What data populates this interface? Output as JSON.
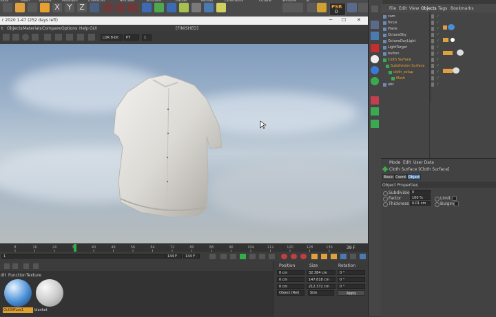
{
  "top_menu": [
    "Tools",
    "Mesh",
    "Volume",
    "MoGraph",
    "Character",
    "Animate",
    "Simulate",
    "Tracker",
    "Render",
    "Extensions",
    "Octane",
    "Window",
    "Script",
    "Help"
  ],
  "psr": {
    "label": "PSR",
    "value": "0"
  },
  "render_window": {
    "title": "r 2020 1-47 (252 days left)",
    "menu": [
      "t",
      "Objects",
      "Materials",
      "Compare",
      "Options",
      "Help",
      "GUI"
    ],
    "status": "[FINISHED]",
    "ldr": "LDR 8-bit",
    "pt": "PT",
    "pt_value": "1"
  },
  "window_controls": {
    "minimize": "─",
    "maximize": "☐",
    "close": "✕"
  },
  "timeline": {
    "ticks": [
      "8",
      "16",
      "24",
      "32",
      "40",
      "48",
      "56",
      "64",
      "72",
      "80",
      "88",
      "96",
      "104",
      "112",
      "120",
      "128",
      "136"
    ],
    "current_frame_fraction": 0.2,
    "end_frame": "39 F",
    "start_field": "1",
    "frame_field": "144 F",
    "frame_field2": "144 F"
  },
  "coords": {
    "headers": [
      "Position",
      "Size",
      "Rotation"
    ],
    "rows": [
      {
        "pos": "0 cm",
        "size": "32.384 cm",
        "rot": "0 °"
      },
      {
        "pos": "0 cm",
        "size": "147.818 cm",
        "rot": "0 °"
      },
      {
        "pos": "0 cm",
        "size": "212.372 cm",
        "rot": "0 °"
      }
    ],
    "mode": "Object (Rel)",
    "size_mode": "Size",
    "apply": "Apply"
  },
  "materials": {
    "menu": [
      "dit",
      "Function",
      "Texture"
    ],
    "items": [
      "OctDiffuse1",
      "blanket"
    ]
  },
  "object_manager": {
    "menu": [
      "File",
      "Edit",
      "View",
      "Objects",
      "Tags",
      "Bookmarks"
    ],
    "objects": [
      {
        "name": "cam",
        "indent": 0,
        "color": "#cfcfcf"
      },
      {
        "name": "focus",
        "indent": 0,
        "color": "#cfcfcf"
      },
      {
        "name": "Plane",
        "indent": 0,
        "color": "#cfcfcf"
      },
      {
        "name": "OctaneSky",
        "indent": 0,
        "color": "#cfcfcf"
      },
      {
        "name": "OctaneDayLight",
        "indent": 0,
        "color": "#cfcfcf"
      },
      {
        "name": "LightTarget",
        "indent": 0,
        "color": "#cfcfcf"
      },
      {
        "name": "button",
        "indent": 0,
        "color": "#cfcfcf"
      },
      {
        "name": "Cloth Surface",
        "indent": 0,
        "color": "#e8b040"
      },
      {
        "name": "Subdivision Surface",
        "indent": 1,
        "color": "#e8a030"
      },
      {
        "name": "cloth_setup",
        "indent": 2,
        "color": "#e8a030"
      },
      {
        "name": "Mesh",
        "indent": 3,
        "color": "#e8a030"
      },
      {
        "name": "abc",
        "indent": 0,
        "color": "#cfcfcf"
      }
    ]
  },
  "attributes": {
    "menu": [
      "Mode",
      "Edit",
      "User Data"
    ],
    "object_title": "Cloth Surface [Cloth Surface]",
    "tabs": [
      "Basic",
      "Coord.",
      "Object"
    ],
    "section": "Object Properties",
    "subdivisions_label": "Subdivisions",
    "subdivisions_value": "0",
    "factor_label": "Factor",
    "factor_value": "100 %",
    "limit_label": "Limit",
    "thickness_label": "Thickness",
    "thickness_value": "0.01 cm",
    "bulging_label": "Bulging"
  },
  "colors": {
    "accent": "#e8a030",
    "selected": "#4a7ab0",
    "playhead": "#2fae4a"
  }
}
